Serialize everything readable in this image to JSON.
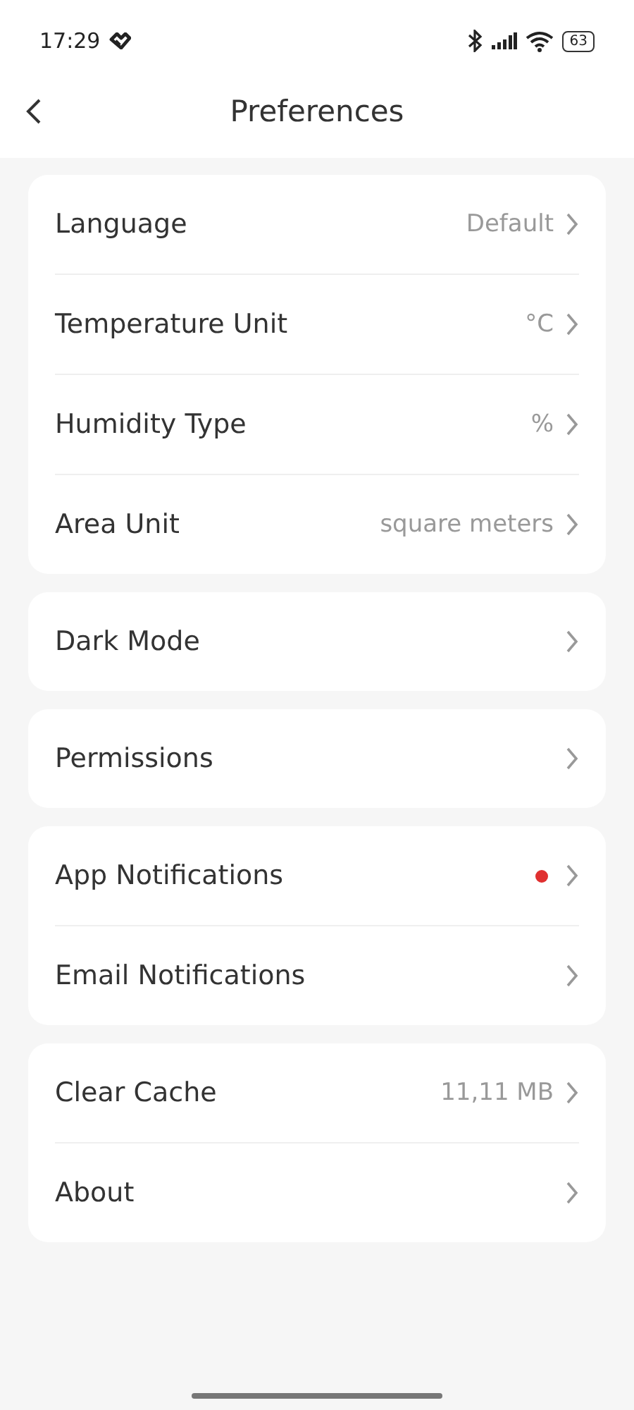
{
  "status_bar": {
    "time": "17:29",
    "battery": "63"
  },
  "header": {
    "title": "Preferences"
  },
  "groups": [
    {
      "items": [
        {
          "label": "Language",
          "value": "Default",
          "dot": false
        },
        {
          "label": "Temperature Unit",
          "value": "°C",
          "dot": false
        },
        {
          "label": "Humidity Type",
          "value": "%",
          "dot": false
        },
        {
          "label": "Area Unit",
          "value": "square meters",
          "dot": false
        }
      ]
    },
    {
      "items": [
        {
          "label": "Dark Mode",
          "dot": false
        }
      ]
    },
    {
      "items": [
        {
          "label": "Permissions",
          "dot": false
        }
      ]
    },
    {
      "items": [
        {
          "label": "App Notifications",
          "dot": true
        },
        {
          "label": "Email Notifications",
          "dot": false
        }
      ]
    },
    {
      "items": [
        {
          "label": "Clear Cache",
          "value": "11,11 MB",
          "dot": false
        },
        {
          "label": "About",
          "dot": false
        }
      ]
    }
  ]
}
